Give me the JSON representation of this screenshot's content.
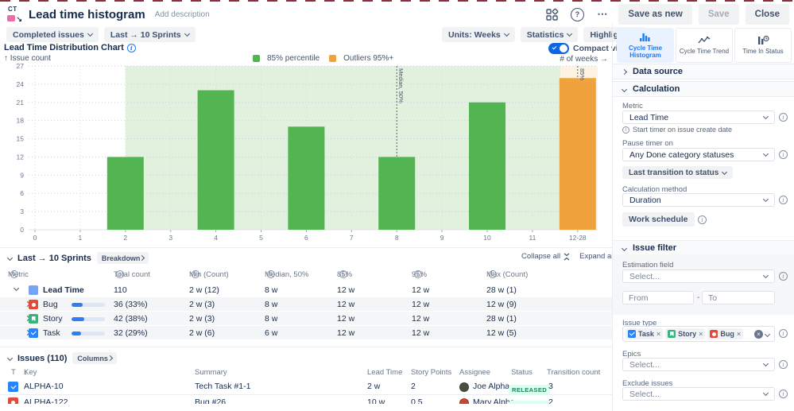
{
  "colors": {
    "green": "#53b552",
    "light_green": "#e2f1de",
    "orange": "#f0a33c",
    "light_orange": "#fdf2df",
    "blue": "#1d7afc",
    "badge_green": "#1f845a"
  },
  "header": {
    "logo": "CT",
    "title": "Lead time histogram",
    "add_description": "Add description",
    "save_as_new": "Save as new",
    "save": "Save",
    "close": "Close"
  },
  "toolbar": {
    "completed_issues": "Completed issues",
    "sprints": "Last → 10 Sprints",
    "units": "Units: Weeks",
    "statistics": "Statistics",
    "highlights": "Highlights"
  },
  "view_tabs": [
    {
      "label": "Cycle Time Histogram"
    },
    {
      "label": "Cycle Time Trend"
    },
    {
      "label": "Time In Status"
    }
  ],
  "panel": {
    "data_source": "Data source",
    "calculation": {
      "title": "Calculation",
      "metric_label": "Metric",
      "metric_value": "Lead Time",
      "metric_hint": "Start timer on issue create date",
      "pause_label": "Pause timer on",
      "pause_value": "Any Done category statuses",
      "transition_button": "Last transition to status",
      "method_label": "Calculation method",
      "method_value": "Duration",
      "work_schedule": "Work schedule"
    },
    "issue_filter": {
      "title": "Issue filter",
      "estimation_label": "Estimation field",
      "estimation_value": "Select...",
      "from_placeholder": "From",
      "separator": "-",
      "to_placeholder": "To",
      "issue_type_label": "Issue type",
      "issue_types": [
        "Task",
        "Story",
        "Bug"
      ],
      "epics_label": "Epics",
      "epics_value": "Select...",
      "exclude_label": "Exclude issues",
      "exclude_value": "Select..."
    }
  },
  "chart": {
    "title": "Lead Time Distribution Chart",
    "y_label": "↑ Issue count",
    "x_label": "# of weeks →",
    "compact_view": "Compact view"
  },
  "chart_data": {
    "type": "bar",
    "title": "Lead Time Distribution Chart",
    "xlabel": "# of weeks",
    "ylabel": "Issue count",
    "ylim": [
      0,
      27
    ],
    "ytick_step": 3,
    "grid": true,
    "categories": [
      "0",
      "1",
      "2",
      "3",
      "4",
      "5",
      "6",
      "7",
      "8",
      "9",
      "10",
      "11",
      "12-28"
    ],
    "bars": [
      {
        "index": 2,
        "category": "2",
        "value": 12,
        "outlier": false
      },
      {
        "index": 4,
        "category": "4",
        "value": 23,
        "outlier": false
      },
      {
        "index": 6,
        "category": "6",
        "value": 17,
        "outlier": false
      },
      {
        "index": 8,
        "category": "8",
        "value": 12,
        "outlier": false
      },
      {
        "index": 10,
        "category": "10",
        "value": 21,
        "outlier": false
      },
      {
        "index": 12,
        "category": "12-28",
        "value": 25,
        "outlier": true
      }
    ],
    "bar_color": "#53b552",
    "outlier_color": "#f0a33c",
    "bands": [
      {
        "from": 2,
        "to": 11.62,
        "color": "#e2f1de"
      },
      {
        "from": 11.62,
        "to": 12.44,
        "color": "#fdf2df"
      }
    ],
    "annotations": [
      {
        "label": "Median, 50%",
        "index": 8,
        "down_to": 12
      },
      {
        "label": "85%",
        "index": 12,
        "down_to": 25
      }
    ],
    "legend": [
      {
        "label": "85% percentile",
        "color": "#53b552"
      },
      {
        "label": "Outliers 95%+",
        "color": "#f0a33c"
      }
    ]
  },
  "breakdown": {
    "title": "Last → 10 Sprints",
    "breakdown_button": "Breakdown",
    "collapse_all": "Collapse all",
    "expand_all": "Expand all",
    "columns": [
      "Metric",
      "Total count",
      "Min (Count)",
      "Median, 50%",
      "85%",
      "95%",
      "Max (Count)"
    ],
    "rows": [
      {
        "metric": "Lead Time",
        "total": "110",
        "min": "2 w (12)",
        "median": "8 w",
        "p85": "12 w",
        "p95": "12 w",
        "max": "28 w (1)",
        "pct": 0
      },
      {
        "metric": "Bug",
        "total": "36 (33%)",
        "min": "2 w (3)",
        "median": "8 w",
        "p85": "12 w",
        "p95": "12 w",
        "max": "12 w (9)",
        "pct": 33
      },
      {
        "metric": "Story",
        "total": "42 (38%)",
        "min": "2 w (3)",
        "median": "8 w",
        "p85": "12 w",
        "p95": "12 w",
        "max": "28 w (1)",
        "pct": 38
      },
      {
        "metric": "Task",
        "total": "32 (29%)",
        "min": "2 w (6)",
        "median": "6 w",
        "p85": "12 w",
        "p95": "12 w",
        "max": "12 w (5)",
        "pct": 29
      }
    ]
  },
  "issues": {
    "title": "Issues (110)",
    "columns_button": "Columns",
    "columns": [
      "T",
      "Key",
      "Summary",
      "Lead Time",
      "Story Points",
      "Assignee",
      "Status",
      "Transition count"
    ],
    "rows": [
      {
        "key": "ALPHA-10",
        "summary": "Tech Task #1-1",
        "lead_time": "2 w",
        "story_points": "2",
        "assignee": "Joe Alpha",
        "status": "RELEASED",
        "transitions": "3"
      },
      {
        "key": "ALPHA-122",
        "summary": "Bug #26",
        "lead_time": "10 w",
        "story_points": "0.5",
        "assignee": "Mary Alpha",
        "status": "RELEASED",
        "transitions": "2"
      }
    ]
  }
}
